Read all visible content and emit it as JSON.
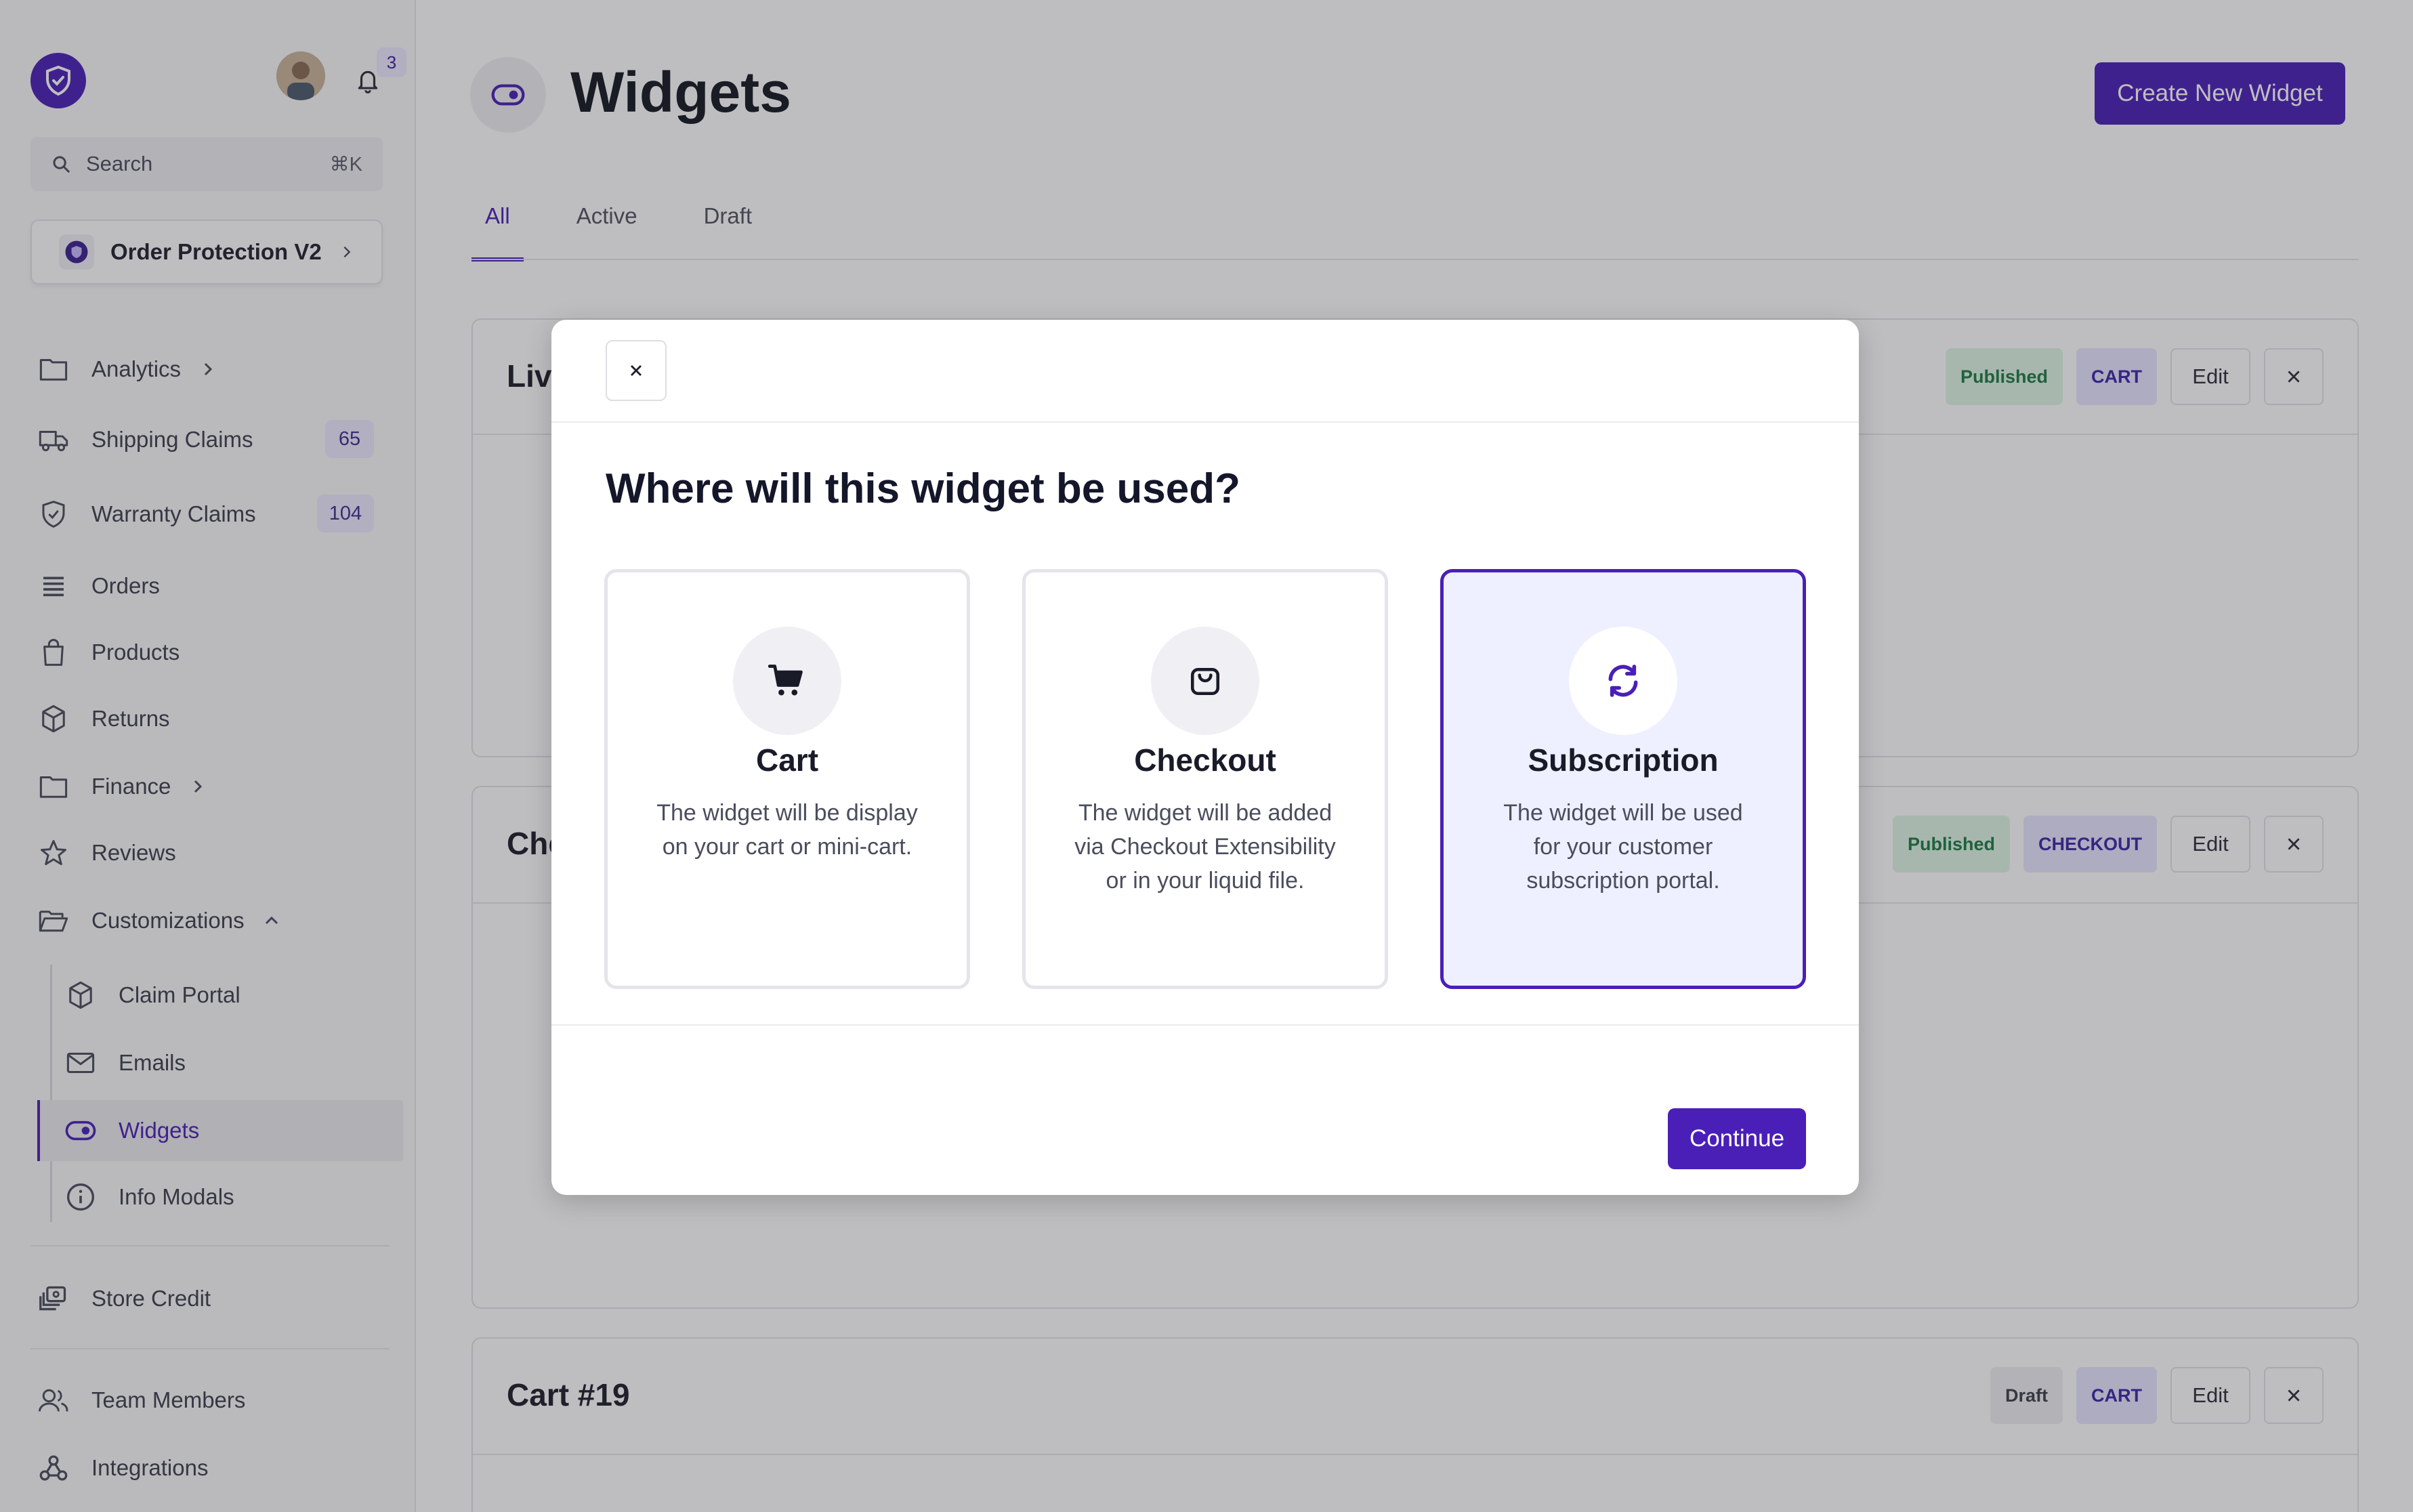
{
  "sidebar": {
    "notifications_count": "3",
    "search": {
      "placeholder": "Search",
      "shortcut": "⌘K"
    },
    "store_name": "Order Protection V2",
    "items": [
      {
        "label": "Analytics"
      },
      {
        "label": "Shipping Claims",
        "count": "65"
      },
      {
        "label": "Warranty Claims",
        "count": "104"
      },
      {
        "label": "Orders"
      },
      {
        "label": "Products"
      },
      {
        "label": "Returns"
      },
      {
        "label": "Finance"
      },
      {
        "label": "Reviews"
      },
      {
        "label": "Customizations"
      }
    ],
    "sub_items": [
      {
        "label": "Claim Portal"
      },
      {
        "label": "Emails"
      },
      {
        "label": "Widgets"
      },
      {
        "label": "Info Modals"
      }
    ],
    "bottom_items": [
      {
        "label": "Store Credit"
      },
      {
        "label": "Team Members"
      },
      {
        "label": "Integrations"
      }
    ]
  },
  "header": {
    "title": "Widgets",
    "create_label": "Create New Widget"
  },
  "tabs": [
    {
      "label": "All"
    },
    {
      "label": "Active"
    },
    {
      "label": "Draft"
    }
  ],
  "cards": [
    {
      "title": "Live",
      "status": "Published",
      "type": "CART",
      "edit_label": "Edit"
    },
    {
      "title": "Che",
      "status": "Published",
      "type": "CHECKOUT",
      "edit_label": "Edit"
    },
    {
      "title": "Cart #19",
      "status": "Draft",
      "type": "CART",
      "edit_label": "Edit"
    }
  ],
  "modal": {
    "title": "Where will this widget be used?",
    "options": [
      {
        "title": "Cart",
        "description": "The widget will be display on your cart or mini-cart."
      },
      {
        "title": "Checkout",
        "description": "The widget will be added via Checkout Extensibility or in your liquid file."
      },
      {
        "title": "Subscription",
        "description": "The widget will be used for your customer subscription portal."
      }
    ],
    "continue_label": "Continue"
  },
  "colors": {
    "brand": "#4a1fb8",
    "published_bg": "#dff5e6",
    "type_bg": "#e8e6ff"
  }
}
